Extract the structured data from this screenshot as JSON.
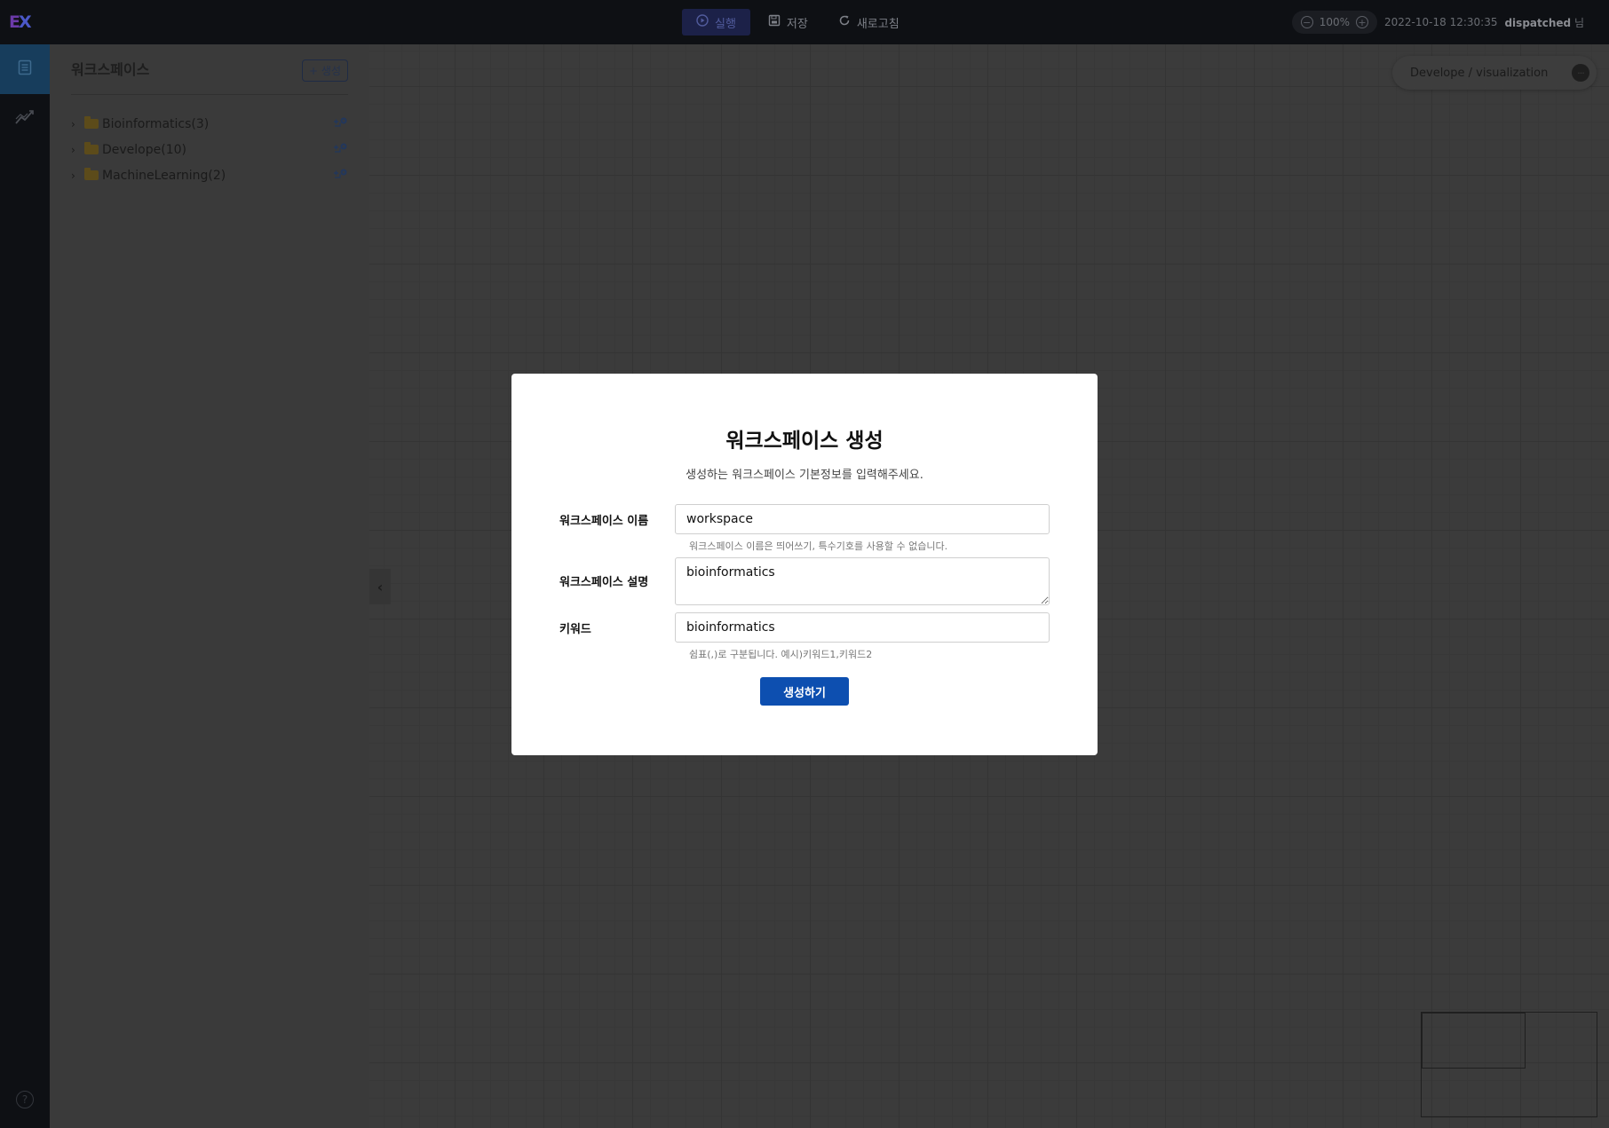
{
  "topbar": {
    "logo_part1": "E",
    "logo_part2": "X",
    "actions": [
      {
        "label": "실행",
        "icon": "play-circle-icon"
      },
      {
        "label": "저장",
        "icon": "save-icon"
      },
      {
        "label": "새로고침",
        "icon": "refresh-icon"
      }
    ],
    "zoom": "100%",
    "datetime": "2022-10-18 12:30:35",
    "username": "dispatched",
    "user_suffix": "님"
  },
  "sidebar": {
    "title": "워크스페이스",
    "create_label": "+ 생성",
    "folders": [
      {
        "label": "Bioinformatics(3)"
      },
      {
        "label": "Develope(10)"
      },
      {
        "label": "MachineLearning(2)"
      }
    ]
  },
  "canvas": {
    "breadcrumb": "Develope / visualization",
    "more_label": "···"
  },
  "modal": {
    "title": "워크스페이스 생성",
    "subtitle": "생성하는 워크스페이스 기본정보를 입력해주세요.",
    "name_label": "워크스페이스 이름",
    "name_value": "workspace",
    "name_hint": "워크스페이스 이름은 띄어쓰기, 특수기호를 사용할 수 없습니다.",
    "desc_label": "워크스페이스 설명",
    "desc_value": "bioinformatics",
    "keyword_label": "키워드",
    "keyword_value": "bioinformatics",
    "keyword_hint": "쉼표(,)로 구분됩니다. 예시)키워드1,키워드2",
    "submit_label": "생성하기"
  }
}
